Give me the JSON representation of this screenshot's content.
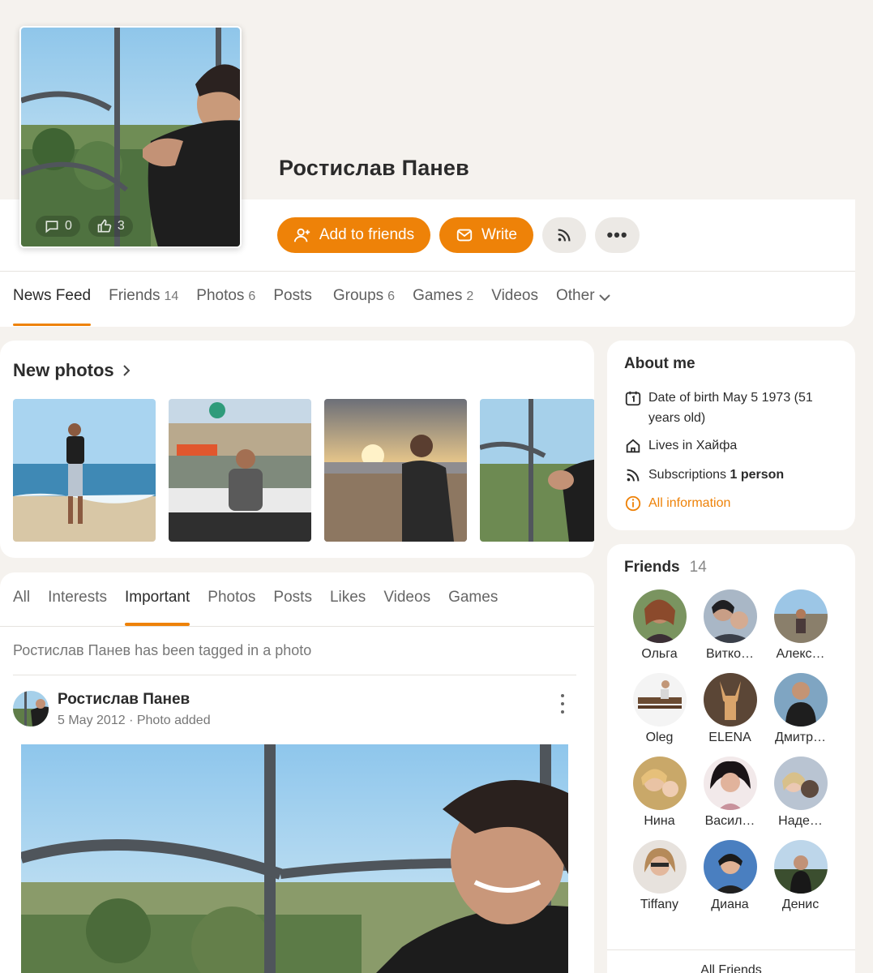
{
  "profile": {
    "name": "Ростислав Панев",
    "avatar_comments": "0",
    "avatar_likes": "3"
  },
  "actions": {
    "add_friends": "Add to friends",
    "write": "Write",
    "more": "•••"
  },
  "nav": {
    "tabs": [
      {
        "label": "News Feed",
        "count": ""
      },
      {
        "label": "Friends",
        "count": "14"
      },
      {
        "label": "Photos",
        "count": "6"
      },
      {
        "label": "Posts",
        "count": ""
      },
      {
        "label": "Groups",
        "count": "6"
      },
      {
        "label": "Games",
        "count": "2"
      },
      {
        "label": "Videos",
        "count": ""
      },
      {
        "label": "Other",
        "count": ""
      }
    ]
  },
  "photos": {
    "title": "New photos"
  },
  "feed": {
    "tabs": [
      "All",
      "Interests",
      "Important",
      "Photos",
      "Posts",
      "Likes",
      "Videos",
      "Games"
    ],
    "note": "Ростислав Панев has been tagged in a photo",
    "post": {
      "author": "Ростислав Панев",
      "date": "5 May 2012",
      "separator": "·",
      "action": "Photo added"
    }
  },
  "about": {
    "title": "About me",
    "birth_line1": "Date of birth May 5 1973 (51",
    "birth_line2": "years old)",
    "lives": "Lives in Хайфа",
    "subs_prefix": "Subscriptions ",
    "subs_value": "1 person",
    "all_info": "All information"
  },
  "friends": {
    "title": "Friends",
    "count": "14",
    "names": [
      "Ольга",
      "Витко…",
      "Алекс…",
      "Oleg",
      "ELENA",
      "Дмитр…",
      "Нина",
      "Васил…",
      "Наде…",
      "Tiffany",
      "Диана",
      "Денис"
    ],
    "all_label": "All Friends"
  },
  "colors": {
    "accent": "#ee8208",
    "background": "#f5f2ee"
  }
}
